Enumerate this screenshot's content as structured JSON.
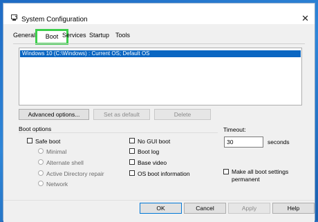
{
  "window": {
    "title": "System Configuration"
  },
  "tabs": [
    {
      "label": "General"
    },
    {
      "label": "Boot"
    },
    {
      "label": "Services"
    },
    {
      "label": "Startup"
    },
    {
      "label": "Tools"
    }
  ],
  "os_list": [
    {
      "label": "Windows 10 (C:\\Windows) : Current OS; Default OS"
    }
  ],
  "buttons": {
    "advanced": "Advanced options...",
    "set_default": "Set as default",
    "delete": "Delete",
    "ok": "OK",
    "cancel": "Cancel",
    "apply": "Apply",
    "help": "Help"
  },
  "boot_options": {
    "title": "Boot options",
    "safe_boot": {
      "label": "Safe boot",
      "checked": false
    },
    "radios": [
      "Minimal",
      "Alternate shell",
      "Active Directory repair",
      "Network"
    ],
    "right": [
      {
        "label": "No GUI boot",
        "checked": false
      },
      {
        "label": "Boot log",
        "checked": false
      },
      {
        "label": "Base video",
        "checked": false
      },
      {
        "label": "OS boot information",
        "checked": false
      }
    ]
  },
  "timeout": {
    "label": "Timeout:",
    "value": "30",
    "unit": "seconds"
  },
  "permanent": {
    "label_line1": "Make all boot settings",
    "label_line2": "permanent",
    "checked": false
  },
  "colors": {
    "highlight": "#0a66c2",
    "tab_outline": "#3ccf4b"
  }
}
